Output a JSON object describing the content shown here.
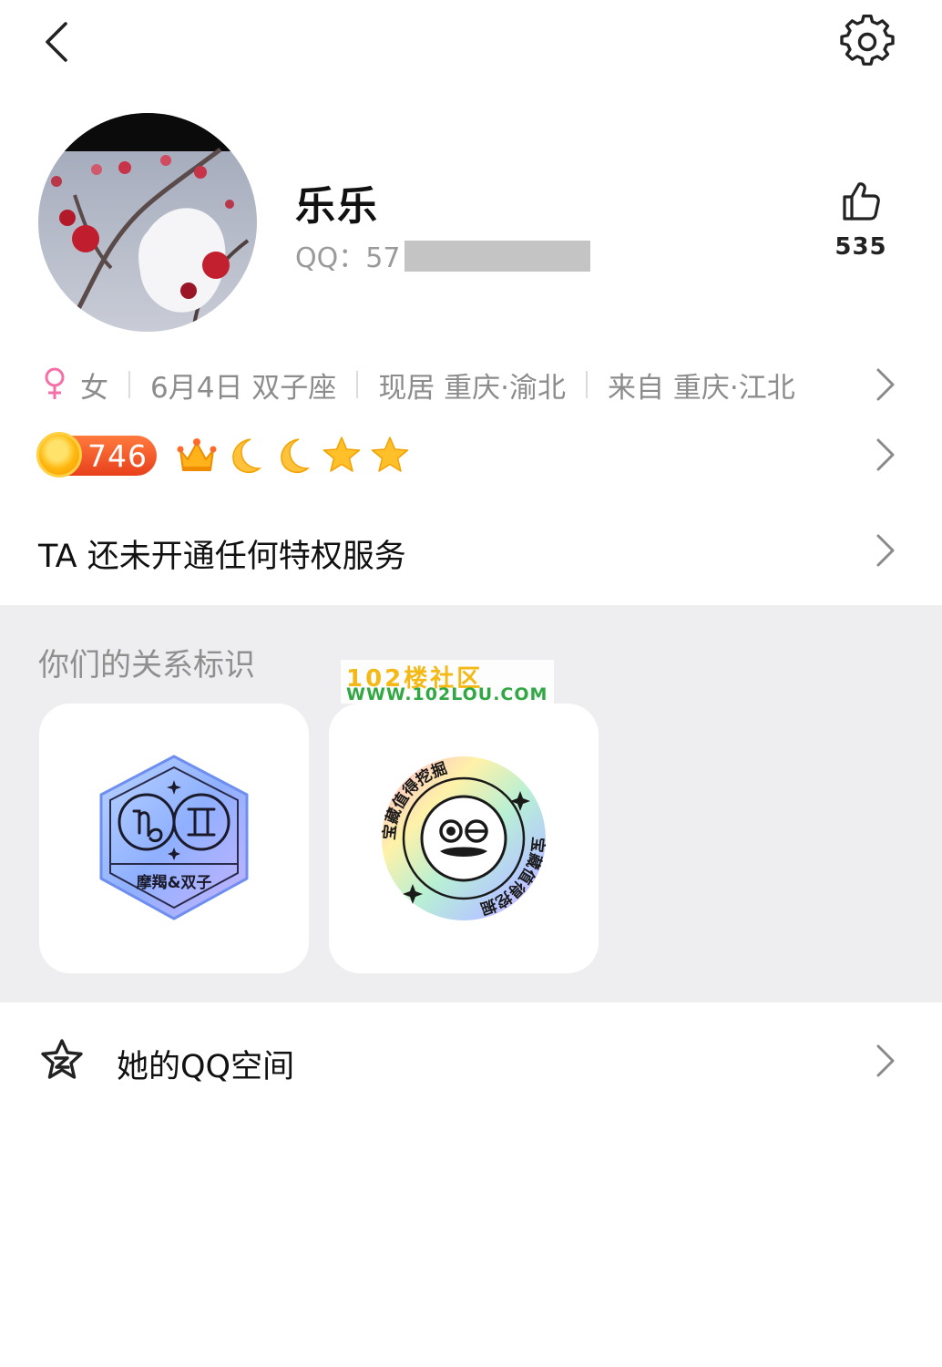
{
  "profile": {
    "nickname": "乐乐",
    "qq_prefix": "QQ：57",
    "likes": "535"
  },
  "info": {
    "gender": "女",
    "birthday": "6月4日 双子座",
    "residence": "现居 重庆·渝北",
    "hometown": "来自 重庆·江北"
  },
  "level": {
    "value": "746",
    "icons": [
      "crown-icon",
      "moon-icon",
      "moon-icon",
      "star-icon",
      "star-icon"
    ]
  },
  "privilege": {
    "text": "TA 还未开通任何特权服务"
  },
  "relationship": {
    "title": "你们的关系标识",
    "badges": [
      {
        "label": "摩羯&双子",
        "icon": "zodiac-capricorn-gemini-badge"
      },
      {
        "label": "宝藏值得挖掘",
        "icon": "treasure-badge"
      }
    ]
  },
  "watermark": {
    "line1": "102楼社区",
    "line2": "WWW.102LOU.COM"
  },
  "zone": {
    "label": "她的QQ空间"
  },
  "colors": {
    "female": "#f66fa8",
    "level_badge": "#e8401c",
    "section_bg": "#eeeef0"
  }
}
